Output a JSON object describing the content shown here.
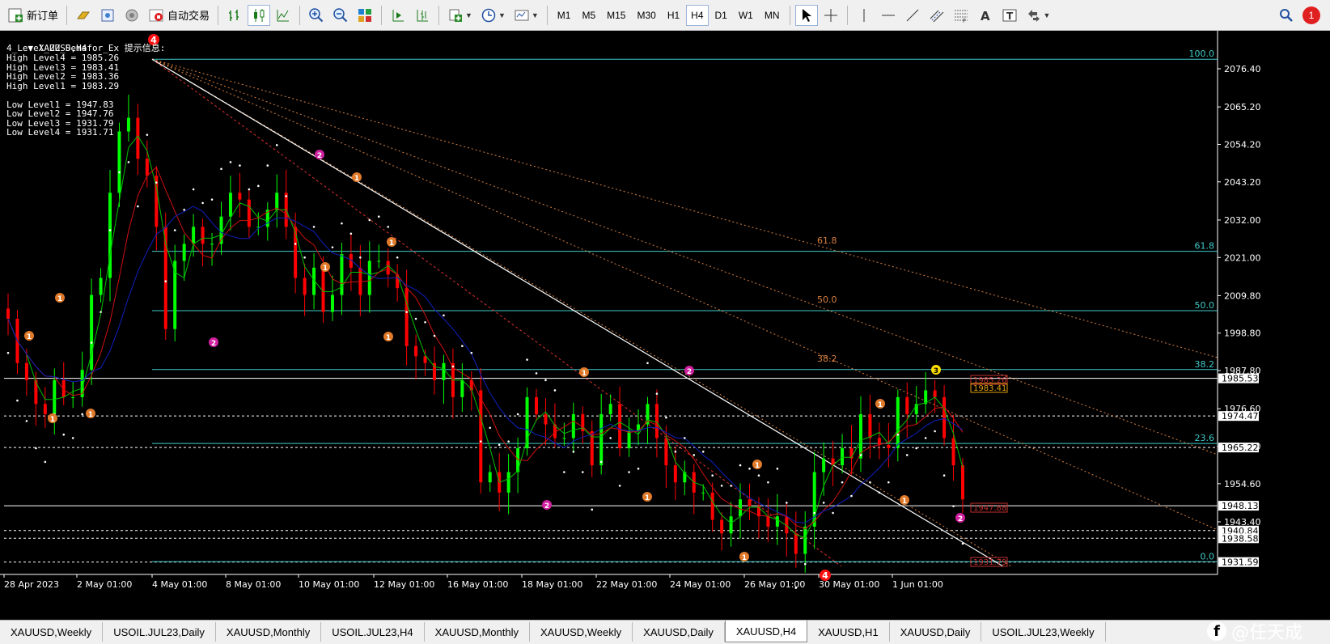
{
  "toolbar": {
    "new_order_label": "新订单",
    "auto_trade_label": "自动交易",
    "timeframes": [
      "M1",
      "M5",
      "M15",
      "M30",
      "H1",
      "H4",
      "D1",
      "W1",
      "MN"
    ],
    "active_timeframe": "H4",
    "notification_count": "1"
  },
  "chart": {
    "symbol_label": "XAUUSD,H4",
    "indicator_title": "4_Level_ZZ_Semafor_Ex 提示信息:",
    "levels": [
      "High Level4 = 1985.26",
      "High Level3 = 1983.41",
      "High Level2 = 1983.36",
      "High Level1 = 1983.29",
      "",
      "Low Level1 = 1947.83",
      "Low Level2 = 1947.76",
      "Low Level3 = 1931.79",
      "Low Level4 = 1931.71"
    ],
    "price_ticks": [
      "2076.40",
      "2065.20",
      "2054.20",
      "2043.20",
      "2032.00",
      "2021.00",
      "2009.80",
      "1998.80",
      "1987.80",
      "1976.60",
      "1965.60",
      "1954.60",
      "1943.40"
    ],
    "price_labels": [
      {
        "text": "1985.53",
        "bg": "#ffffff",
        "fg": "#000000",
        "price": 1985.53
      },
      {
        "text": "1974.47",
        "bg": "#ffffff",
        "fg": "#000000",
        "price": 1974.47
      },
      {
        "text": "1965.22",
        "bg": "#ffffff",
        "fg": "#000000",
        "price": 1965.22
      },
      {
        "text": "1948.13",
        "bg": "#ffffff",
        "fg": "#000000",
        "price": 1948.13
      },
      {
        "text": "1940.84",
        "bg": "#ffffff",
        "fg": "#000000",
        "price": 1940.84
      },
      {
        "text": "1938.58",
        "bg": "#ffffff",
        "fg": "#000000",
        "price": 1938.58
      },
      {
        "text": "1931.59",
        "bg": "#ffffff",
        "fg": "#000000",
        "price": 1931.59
      }
    ],
    "fib_levels": [
      {
        "label": "100.0",
        "price": 2079.2
      },
      {
        "label": "61.8",
        "price": 2022.8
      },
      {
        "label": "50.0",
        "price": 2005.4
      },
      {
        "label": "38.2",
        "price": 1988.1
      },
      {
        "label": "23.6",
        "price": 1966.4
      },
      {
        "label": "0.0",
        "price": 1931.7
      }
    ],
    "fan_labels": [
      "61.8",
      "50.0",
      "38.2"
    ],
    "boxed_labels": [
      "1985.26",
      "1983.41",
      "1947.88",
      "1931.79"
    ],
    "date_labels": [
      "28 Apr 2023",
      "2 May 01:00",
      "4 May 01:00",
      "8 May 01:00",
      "10 May 01:00",
      "12 May 01:00",
      "16 May 01:00",
      "18 May 01:00",
      "22 May 01:00",
      "24 May 01:00",
      "26 May 01:00",
      "30 May 01:00",
      "1 Jun 01:00"
    ],
    "semafor_markers": [
      {
        "n": "1",
        "c": "#e07a2a"
      },
      {
        "n": "2",
        "c": "#d020a0"
      },
      {
        "n": "3",
        "c": "#ffe000"
      },
      {
        "n": "4",
        "c": "#ff1010"
      }
    ],
    "colors": {
      "bull": "#00ff00",
      "bear": "#ff0000",
      "ma_fast": "#00c000",
      "ma_mid": "#d01010",
      "ma_slow": "#1020c0",
      "fib": "#40c8c8",
      "fan": "#d88040"
    }
  },
  "tabs": {
    "items": [
      "XAUUSD,Weekly",
      "USOIL.JUL23,Daily",
      "XAUUSD,Monthly",
      "USOIL.JUL23,H4",
      "XAUUSD,Monthly",
      "XAUUSD,Weekly",
      "XAUUSD,Daily",
      "XAUUSD,H4",
      "XAUUSD,H1",
      "XAUUSD,Daily",
      "USOIL.JUL23,Weekly"
    ],
    "active_index": 7
  },
  "watermark": "@任天成"
}
